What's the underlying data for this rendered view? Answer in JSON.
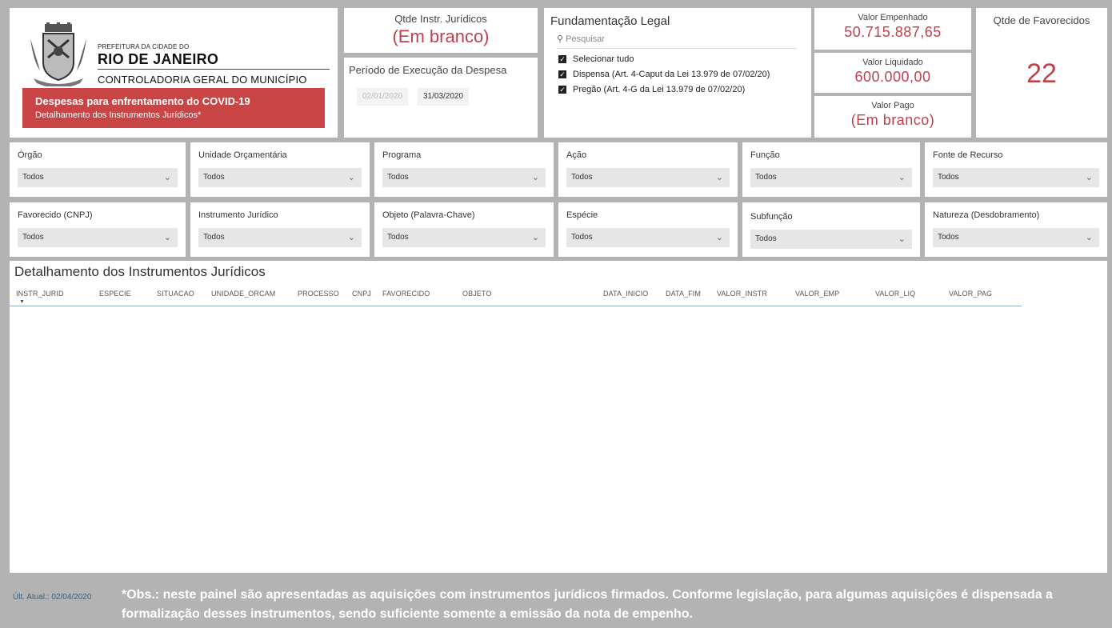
{
  "header": {
    "pref_small": "PREFEITURA DA CIDADE DO",
    "pref_big": "RIO DE JANEIRO",
    "cgm": "CONTROLADORIA GERAL DO MUNICÍPIO",
    "banner_title": "Despesas para enfrentamento do COVID-19",
    "banner_subtitle": "Detalhamento dos Instrumentos Jurídicos*"
  },
  "qtde_instr": {
    "label": "Qtde Instr. Jurídicos",
    "value": "(Em branco)"
  },
  "periodo": {
    "label": "Período de Execução da Despesa",
    "start": "02/01/2020",
    "end": "31/03/2020"
  },
  "fundamentacao": {
    "title": "Fundamentação Legal",
    "search_placeholder": "Pesquisar",
    "options": [
      "Selecionar tudo",
      "Dispensa (Art. 4-Caput da Lei 13.979 de 07/02/20)",
      "Pregão (Art. 4-G da Lei 13.979 de 07/02/20)"
    ]
  },
  "valores": {
    "empenhado": {
      "label": "Valor Empenhado",
      "value": "50.715.887,65"
    },
    "liquidado": {
      "label": "Valor Liquidado",
      "value": "600.000,00"
    },
    "pago": {
      "label": "Valor Pago",
      "value": "(Em branco)"
    }
  },
  "favorecidos": {
    "label": "Qtde de Favorecidos",
    "value": "22"
  },
  "filters_row1": [
    {
      "label": "Órgão",
      "value": "Todos"
    },
    {
      "label": "Unidade Orçamentária",
      "value": "Todos"
    },
    {
      "label": "Programa",
      "value": "Todos"
    },
    {
      "label": "Ação",
      "value": "Todos"
    },
    {
      "label": "Função",
      "value": "Todos"
    },
    {
      "label": "Fonte de Recurso",
      "value": "Todos"
    }
  ],
  "filters_row2": [
    {
      "label": "Favorecido (CNPJ)",
      "value": "Todos"
    },
    {
      "label": "Instrumento Jurídico",
      "value": "Todos"
    },
    {
      "label": "Objeto (Palavra-Chave)",
      "value": "Todos"
    },
    {
      "label": "Espécie",
      "value": "Todos"
    },
    {
      "label": "Subfunção",
      "value": "Todos"
    },
    {
      "label": "Natureza (Desdobramento)",
      "value": "Todos"
    }
  ],
  "table": {
    "title": "Detalhamento dos Instrumentos Jurídicos",
    "columns": [
      "INSTR_JURID",
      "ESPECIE",
      "SITUACAO",
      "UNIDADE_ORCAM",
      "PROCESSO",
      "CNPJ",
      "FAVORECIDO",
      "OBJETO",
      "DATA_INICIO",
      "DATA_FIM",
      "VALOR_INSTR",
      "VALOR_EMP",
      "VALOR_LIQ",
      "VALOR_PAG"
    ]
  },
  "footer": {
    "updated": "Últ. Atual.: 02/04/2020",
    "obs": "*Obs.: neste painel são apresentadas as aquisições com instrumentos jurídicos firmados. Conforme legislação, para algumas aquisições é dispensada a formalização desses instrumentos, sendo suficiente somente a emissão da nota de empenho."
  }
}
